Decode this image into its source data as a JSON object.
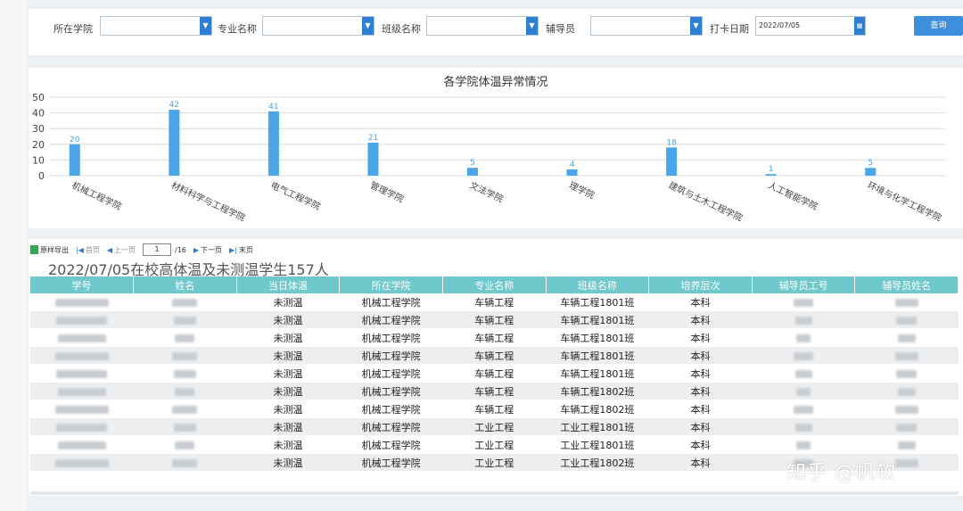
{
  "filters": {
    "college_label": "所在学院",
    "major_label": "专业名称",
    "class_label": "班级名称",
    "counselor_label": "辅导员",
    "date_label": "打卡日期",
    "date_value": "2022/07/05",
    "query_button": "查询"
  },
  "chart_data": {
    "type": "bar",
    "title": "各学院体温异常情况",
    "categories": [
      "机械工程学院",
      "材料科学与工程学院",
      "电气工程学院",
      "管理学院",
      "文法学院",
      "理学院",
      "建筑与土木工程学院",
      "人工智能学院",
      "环境与化学工程学院"
    ],
    "values": [
      20,
      42,
      41,
      21,
      5,
      4,
      18,
      1,
      5
    ],
    "ylim": [
      0,
      50
    ],
    "yticks": [
      0,
      10,
      20,
      30,
      40,
      50
    ],
    "grid": true,
    "bar_color": "#4aa6e8"
  },
  "toolbar": {
    "export_label": "原样导出",
    "first_label": "首页",
    "prev_label": "上一页",
    "page_value": "1",
    "page_total": "/16",
    "next_label": "下一页",
    "last_label": "末页"
  },
  "report": {
    "title": "2022/07/05在校高体温及未测温学生157人",
    "columns": [
      "学号",
      "姓名",
      "当日体温",
      "所在学院",
      "专业名称",
      "班级名称",
      "培养层次",
      "辅导员工号",
      "辅导员姓名"
    ],
    "rows": [
      [
        "",
        "",
        "未测温",
        "机械工程学院",
        "车辆工程",
        "车辆工程1801班",
        "本科",
        "",
        ""
      ],
      [
        "",
        "",
        "未测温",
        "机械工程学院",
        "车辆工程",
        "车辆工程1801班",
        "本科",
        "",
        ""
      ],
      [
        "",
        "",
        "未测温",
        "机械工程学院",
        "车辆工程",
        "车辆工程1801班",
        "本科",
        "",
        ""
      ],
      [
        "",
        "",
        "未测温",
        "机械工程学院",
        "车辆工程",
        "车辆工程1801班",
        "本科",
        "",
        ""
      ],
      [
        "",
        "",
        "未测温",
        "机械工程学院",
        "车辆工程",
        "车辆工程1801班",
        "本科",
        "",
        ""
      ],
      [
        "",
        "",
        "未测温",
        "机械工程学院",
        "车辆工程",
        "车辆工程1802班",
        "本科",
        "",
        ""
      ],
      [
        "",
        "",
        "未测温",
        "机械工程学院",
        "车辆工程",
        "车辆工程1802班",
        "本科",
        "",
        ""
      ],
      [
        "",
        "",
        "未测温",
        "机械工程学院",
        "工业工程",
        "工业工程1801班",
        "本科",
        "",
        ""
      ],
      [
        "",
        "",
        "未测温",
        "机械工程学院",
        "工业工程",
        "工业工程1801班",
        "本科",
        "",
        ""
      ],
      [
        "",
        "",
        "未测温",
        "机械工程学院",
        "工业工程",
        "工业工程1802班",
        "本科",
        "",
        ""
      ]
    ]
  },
  "watermark": "知乎 @帆软"
}
